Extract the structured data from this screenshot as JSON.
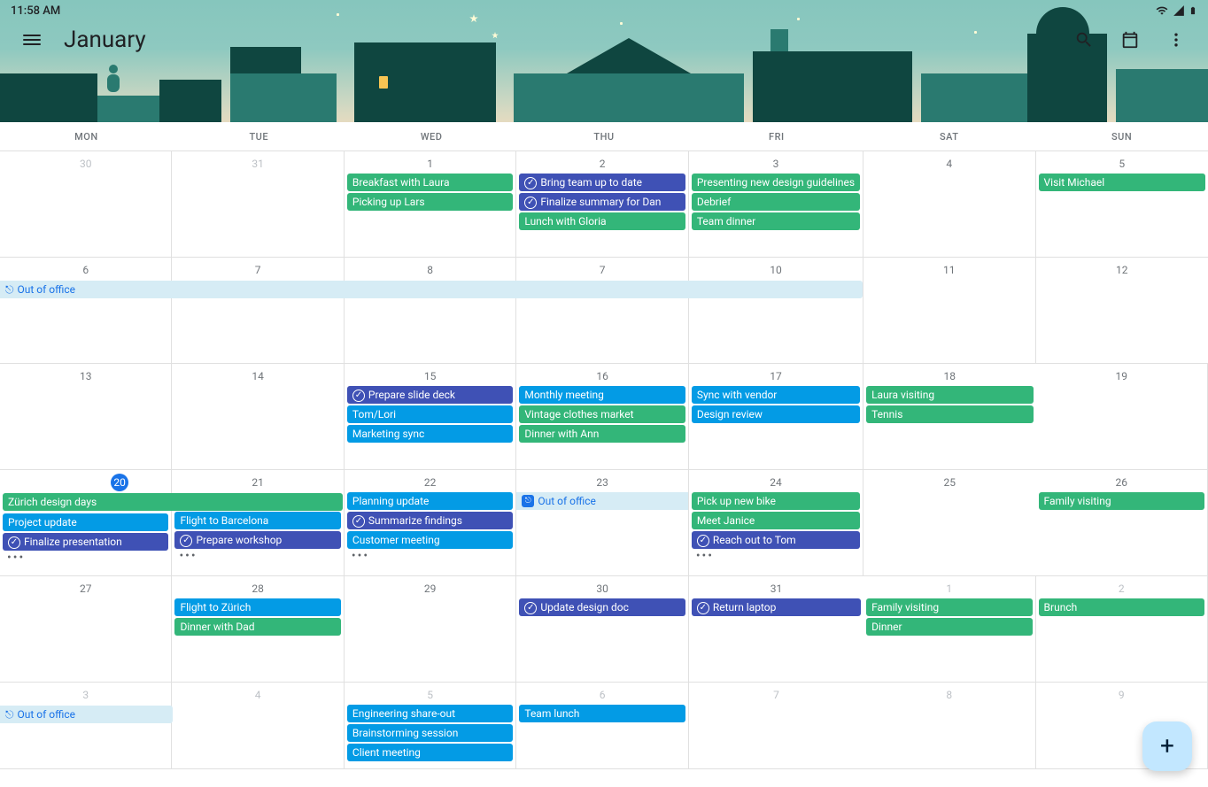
{
  "status_bar": {
    "time": "11:58 AM"
  },
  "header": {
    "month": "January"
  },
  "day_headers": [
    "MON",
    "TUE",
    "WED",
    "THU",
    "FRI",
    "SAT",
    "SUN"
  ],
  "colors": {
    "green": "#33b679",
    "blue": "#039be5",
    "indigo": "#3f51b5",
    "oob_bg": "#d6ecf5",
    "oob_fg": "#1a73e8",
    "today": "#1a73e8"
  },
  "weeks": [
    {
      "days": [
        {
          "num": "30",
          "other": true,
          "events": []
        },
        {
          "num": "31",
          "other": true,
          "events": []
        },
        {
          "num": "1",
          "events": [
            {
              "label": "Breakfast with Laura",
              "color": "green"
            },
            {
              "label": "Picking up Lars",
              "color": "green"
            }
          ]
        },
        {
          "num": "2",
          "events": [
            {
              "label": "Bring team up to date",
              "color": "indigo",
              "check": true
            },
            {
              "label": "Finalize summary for Dan",
              "color": "indigo",
              "check": true
            },
            {
              "label": "Lunch with Gloria",
              "color": "green"
            }
          ]
        },
        {
          "num": "3",
          "events": [
            {
              "label": "Presenting new design guidelines",
              "color": "green"
            },
            {
              "label": "Debrief",
              "color": "green"
            },
            {
              "label": "Team dinner",
              "color": "green"
            }
          ]
        },
        {
          "num": "4",
          "events": []
        },
        {
          "num": "5",
          "events": [
            {
              "label": "Visit Michael",
              "color": "green"
            }
          ]
        }
      ]
    },
    {
      "span": {
        "label": "Out of office",
        "type": "oob",
        "start": 0,
        "cols": 5
      },
      "days": [
        {
          "num": "6",
          "events": []
        },
        {
          "num": "7",
          "events": []
        },
        {
          "num": "8",
          "events": []
        },
        {
          "num": "7",
          "events": []
        },
        {
          "num": "10",
          "events": []
        },
        {
          "num": "11",
          "events": []
        },
        {
          "num": "12",
          "events": []
        }
      ]
    },
    {
      "days": [
        {
          "num": "13",
          "events": []
        },
        {
          "num": "14",
          "events": []
        },
        {
          "num": "15",
          "events": [
            {
              "label": "Prepare slide deck",
              "color": "indigo",
              "check": true
            },
            {
              "label": "Tom/Lori",
              "color": "blue"
            },
            {
              "label": "Marketing sync",
              "color": "blue"
            }
          ]
        },
        {
          "num": "16",
          "events": [
            {
              "label": "Monthly meeting",
              "color": "blue"
            },
            {
              "label": "Vintage clothes market",
              "color": "green"
            },
            {
              "label": "Dinner with Ann",
              "color": "green"
            }
          ]
        },
        {
          "num": "17",
          "events": [
            {
              "label": "Sync with vendor",
              "color": "blue"
            },
            {
              "label": "Design review",
              "color": "blue"
            }
          ]
        },
        {
          "num": "18",
          "events": [
            {
              "label": "Laura visiting",
              "color": "green"
            },
            {
              "label": "Tennis",
              "color": "green"
            }
          ]
        },
        {
          "num": "19",
          "events": []
        }
      ]
    },
    {
      "span": {
        "label": "Zürich design days",
        "type": "green",
        "start": 0,
        "cols": 2
      },
      "days": [
        {
          "num": "20",
          "today": true,
          "events": [
            {
              "spacer": true
            },
            {
              "label": "Project update",
              "color": "blue"
            },
            {
              "label": "Finalize presentation",
              "color": "indigo",
              "check": true
            }
          ],
          "more": true
        },
        {
          "num": "21",
          "events": [
            {
              "spacer": true
            },
            {
              "label": "Flight to Barcelona",
              "color": "blue"
            },
            {
              "label": "Prepare workshop",
              "color": "indigo",
              "check": true
            }
          ],
          "more": true
        },
        {
          "num": "22",
          "events": [
            {
              "label": "Planning update",
              "color": "blue"
            },
            {
              "label": "Summarize findings",
              "color": "indigo",
              "check": true
            },
            {
              "label": "Customer meeting",
              "color": "blue"
            }
          ],
          "more": true
        },
        {
          "num": "23",
          "events": [
            {
              "label": "Out of office",
              "color": "oob",
              "badge": true
            }
          ]
        },
        {
          "num": "24",
          "events": [
            {
              "label": "Pick up new bike",
              "color": "green"
            },
            {
              "label": "Meet Janice",
              "color": "green"
            },
            {
              "label": "Reach out to Tom",
              "color": "indigo",
              "check": true
            }
          ],
          "more": true
        },
        {
          "num": "25",
          "events": []
        },
        {
          "num": "26",
          "events": [
            {
              "label": "Family visiting",
              "color": "green"
            }
          ]
        }
      ]
    },
    {
      "days": [
        {
          "num": "27",
          "events": []
        },
        {
          "num": "28",
          "events": [
            {
              "label": "Flight to Zürich",
              "color": "blue"
            },
            {
              "label": "Dinner with Dad",
              "color": "green"
            }
          ]
        },
        {
          "num": "29",
          "events": []
        },
        {
          "num": "30",
          "events": [
            {
              "label": "Update design doc",
              "color": "indigo",
              "check": true
            }
          ]
        },
        {
          "num": "31",
          "events": [
            {
              "label": "Return laptop",
              "color": "indigo",
              "check": true
            }
          ]
        },
        {
          "num": "1",
          "other": true,
          "events": [
            {
              "label": "Family visiting",
              "color": "green"
            },
            {
              "label": "Dinner",
              "color": "green"
            }
          ]
        },
        {
          "num": "2",
          "other": true,
          "events": [
            {
              "label": "Brunch",
              "color": "green"
            }
          ]
        }
      ]
    },
    {
      "span": {
        "label": "Out of office",
        "type": "oob-short",
        "start": 0,
        "cols": 1
      },
      "days": [
        {
          "num": "3",
          "other": true,
          "events": []
        },
        {
          "num": "4",
          "other": true,
          "events": []
        },
        {
          "num": "5",
          "other": true,
          "events": [
            {
              "label": "Engineering share-out",
              "color": "blue"
            },
            {
              "label": "Brainstorming session",
              "color": "blue"
            },
            {
              "label": "Client meeting",
              "color": "blue"
            }
          ]
        },
        {
          "num": "6",
          "other": true,
          "events": [
            {
              "label": "Team lunch",
              "color": "blue"
            }
          ]
        },
        {
          "num": "7",
          "other": true,
          "events": []
        },
        {
          "num": "8",
          "other": true,
          "events": []
        },
        {
          "num": "9",
          "other": true,
          "events": []
        }
      ]
    }
  ]
}
